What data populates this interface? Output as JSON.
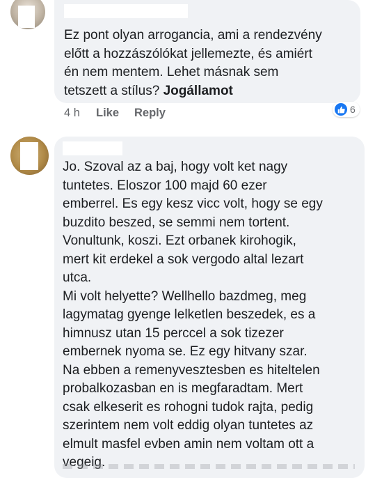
{
  "comments": [
    {
      "text": "Ez pont olyan arrogancia, ami a rendezvény\nelőtt a hozzászólókat jellemezte, és amiért\nén nem mentem. Lehet másnak sem\ntetszett a stílus? ",
      "mention": "Jogállamot",
      "time": "4 h",
      "like_label": "Like",
      "reply_label": "Reply",
      "reaction_count": "6"
    },
    {
      "text": "Jo. Szoval az a baj, hogy volt ket nagy\ntuntetes. Eloszor 100 majd 60 ezer\nemberrel. Es egy kesz vicc volt, hogy se egy\nbuzdito beszed, se semmi nem tortent.\nVonultunk, koszi. Ezt orbanek kirohogik,\nmert kit erdekel a sok vergodo altal lezart\nutca.\nMi volt helyette? Wellhello bazdmeg, meg\nlagymatag gyenge lelketlen beszedek, es a\nhimnusz utan 15 perccel a sok tizezer\nembernek nyoma se. Ez egy hitvany szar.\nNa ebben a remenyvesztesben es hiteltelen\nprobalkozasban en is megfaradtam. Mert\ncsak elkeserit es rohogni tudok rajta, pedig\nszerintem nem volt eddig olyan tuntetes az\nelmult masfel evben amin nem voltam ott a\nvegeig."
    }
  ],
  "icons": {
    "reaction": "like-thumbs-up-icon"
  },
  "colors": {
    "bubble": "#f0f2f5",
    "like_blue": "#1877f2",
    "meta_text": "#65676b"
  }
}
